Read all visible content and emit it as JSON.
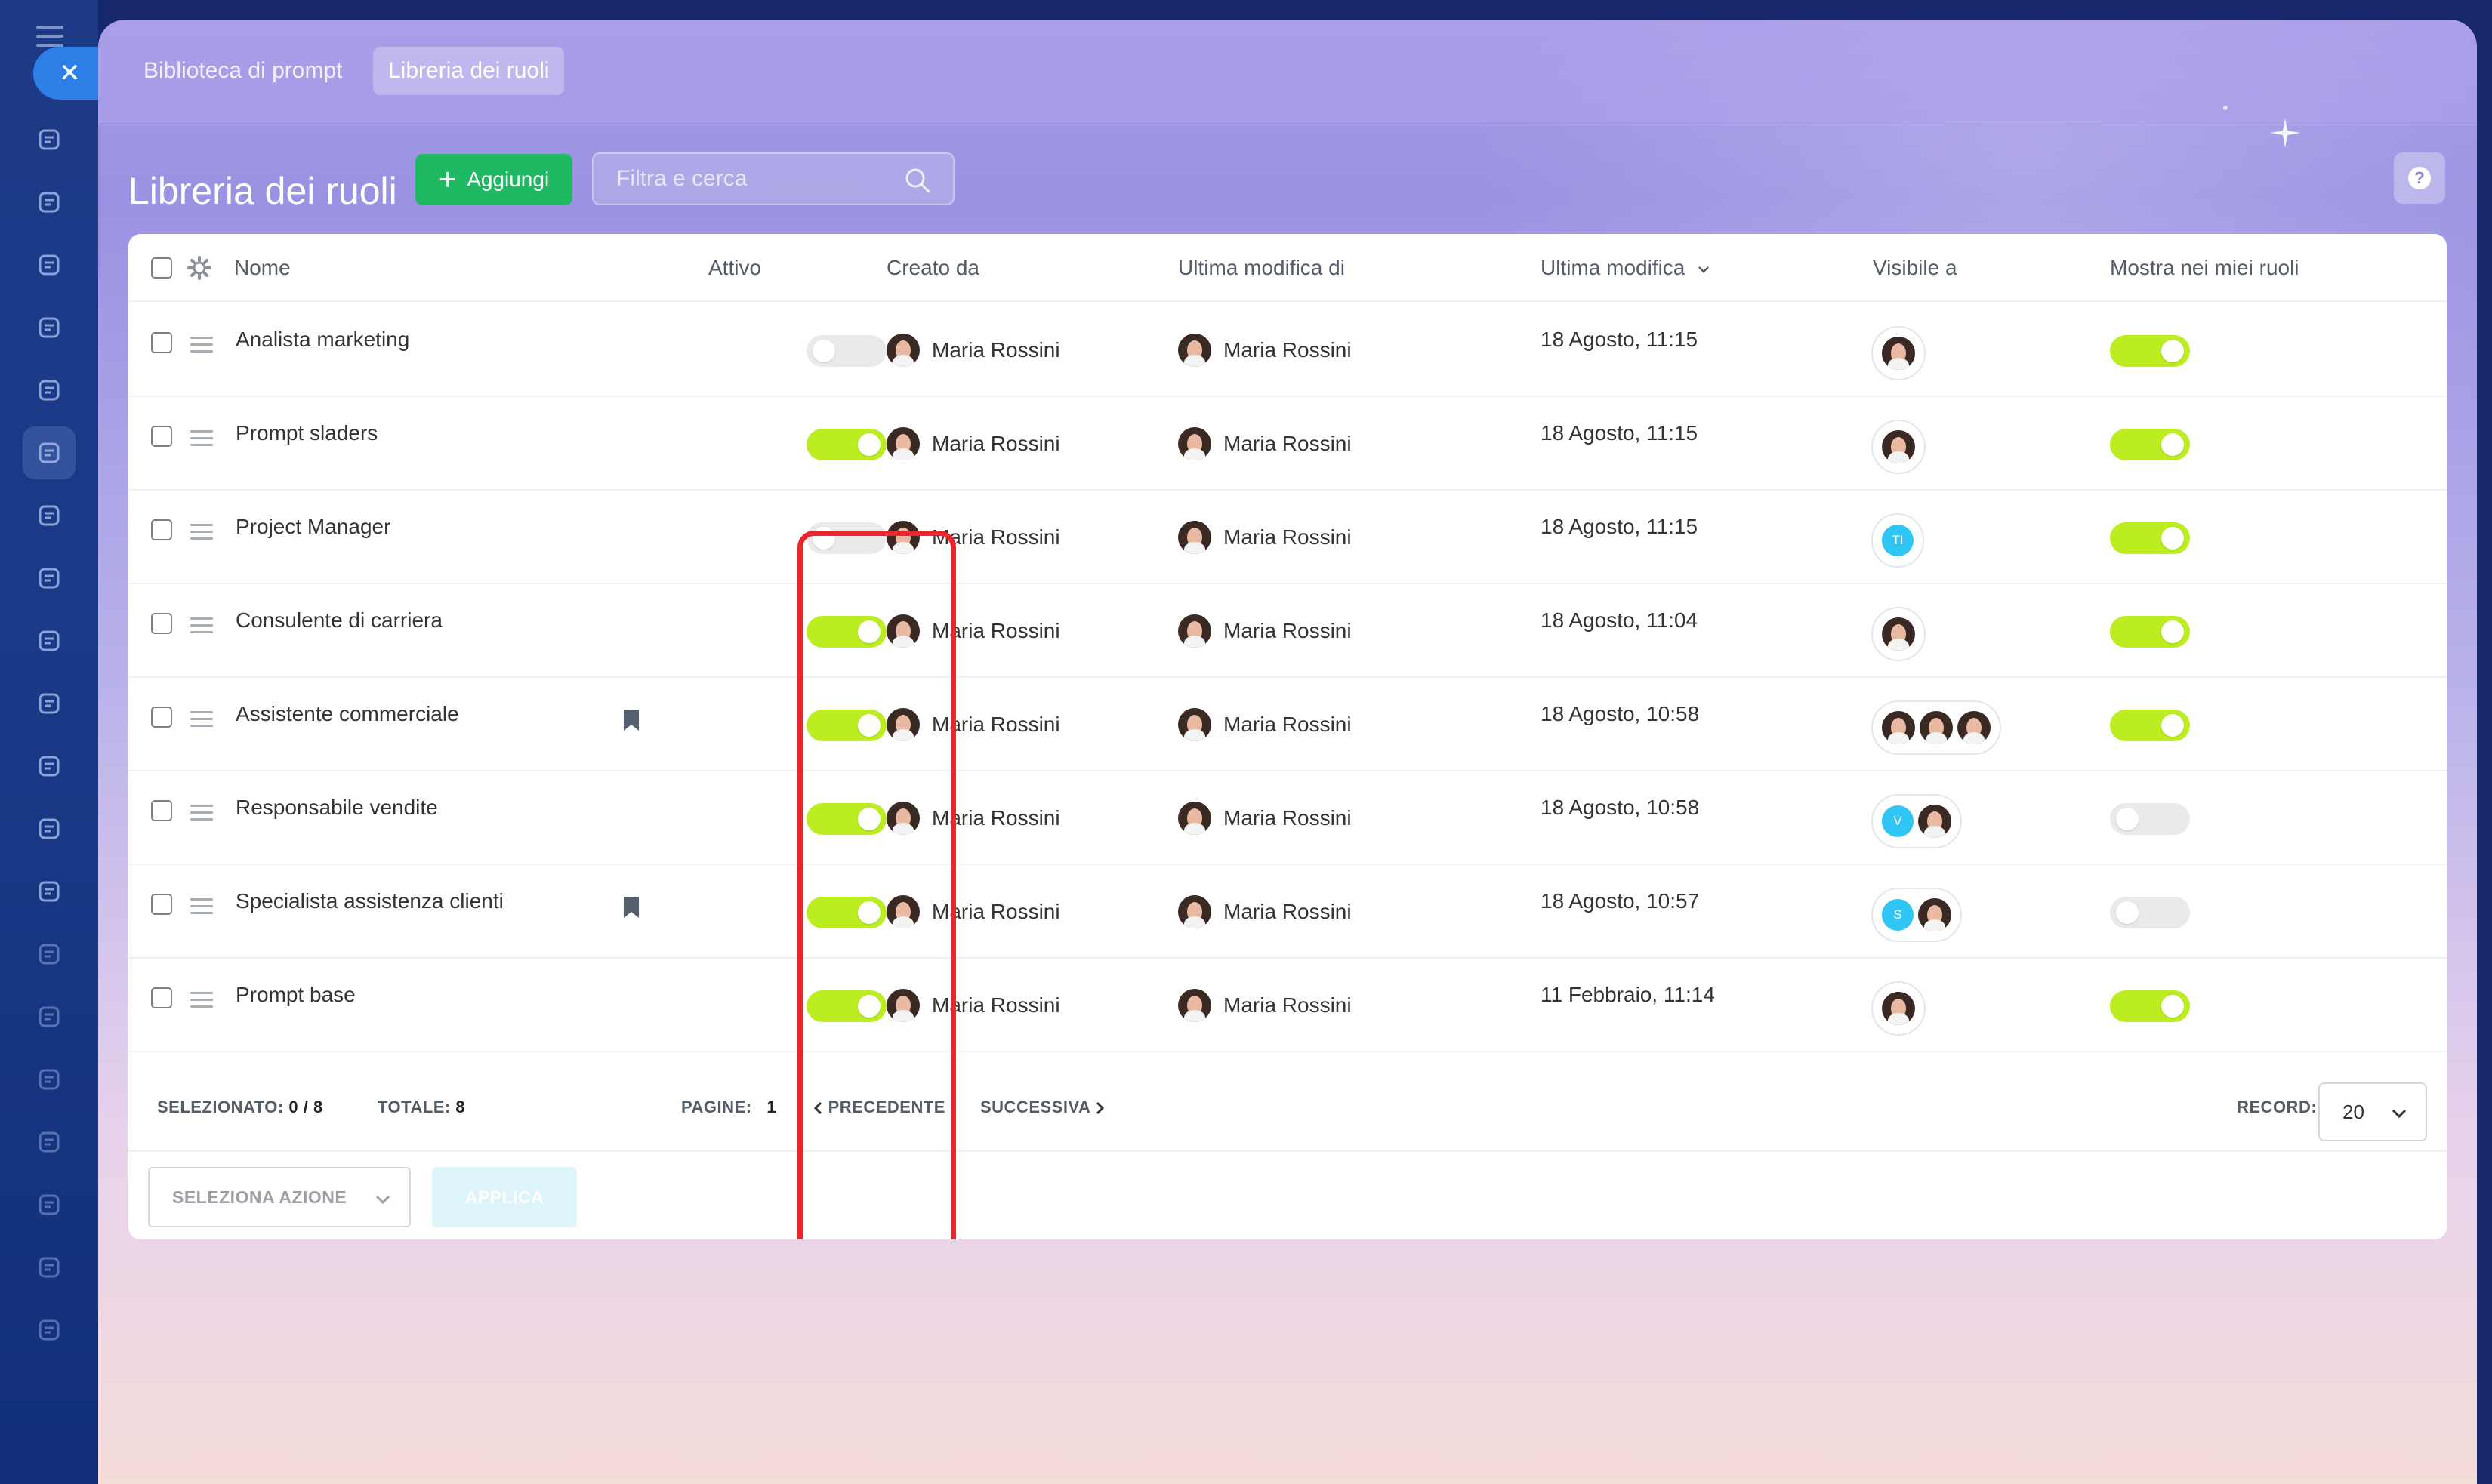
{
  "tabs": [
    {
      "label": "Biblioteca di prompt"
    },
    {
      "label": "Libreria dei ruoli"
    }
  ],
  "header": {
    "title": "Libreria dei ruoli",
    "add_label": "Aggiungi",
    "search_placeholder": "Filtra e cerca"
  },
  "table": {
    "columns": {
      "name": "Nome",
      "active": "Attivo",
      "created_by": "Creato da",
      "modified_by": "Ultima modifica di",
      "modified": "Ultima modifica",
      "visible_to": "Visibile a",
      "show_in_roles": "Mostra nei miei ruoli"
    },
    "rows": [
      {
        "name": "Analista marketing",
        "active": false,
        "created_by": "Maria Rossini",
        "modified_by": "Maria Rossini",
        "modified": "18 Agosto, 11:15",
        "visible_to": [
          "avatar"
        ],
        "show": true,
        "bookmark": false
      },
      {
        "name": "Prompt sladers",
        "active": true,
        "created_by": "Maria Rossini",
        "modified_by": "Maria Rossini",
        "modified": "18 Agosto, 11:15",
        "visible_to": [
          "avatar"
        ],
        "show": true,
        "bookmark": false
      },
      {
        "name": "Project Manager",
        "active": false,
        "created_by": "Maria Rossini",
        "modified_by": "Maria Rossini",
        "modified": "18 Agosto, 11:15",
        "visible_to": [
          "TI"
        ],
        "show": true,
        "bookmark": false
      },
      {
        "name": "Consulente di carriera",
        "active": true,
        "created_by": "Maria Rossini",
        "modified_by": "Maria Rossini",
        "modified": "18 Agosto, 11:04",
        "visible_to": [
          "avatar"
        ],
        "show": true,
        "bookmark": false
      },
      {
        "name": "Assistente commerciale",
        "active": true,
        "created_by": "Maria Rossini",
        "modified_by": "Maria Rossini",
        "modified": "18 Agosto, 10:58",
        "visible_to": [
          "avatar",
          "avatar",
          "avatar"
        ],
        "show": true,
        "bookmark": true
      },
      {
        "name": "Responsabile vendite",
        "active": true,
        "created_by": "Maria Rossini",
        "modified_by": "Maria Rossini",
        "modified": "18 Agosto, 10:58",
        "visible_to": [
          "V",
          "avatar"
        ],
        "show": false,
        "bookmark": false
      },
      {
        "name": "Specialista assistenza clienti",
        "active": true,
        "created_by": "Maria Rossini",
        "modified_by": "Maria Rossini",
        "modified": "18 Agosto, 10:57",
        "visible_to": [
          "S",
          "avatar"
        ],
        "show": false,
        "bookmark": true
      },
      {
        "name": "Prompt base",
        "active": true,
        "created_by": "Maria Rossini",
        "modified_by": "Maria Rossini",
        "modified": "11 Febbraio, 11:14",
        "visible_to": [
          "avatar"
        ],
        "show": true,
        "bookmark": false
      }
    ]
  },
  "footer": {
    "selected_label": "SELEZIONATO:",
    "selected_value": "0 / 8",
    "total_label": "TOTALE:",
    "total_value": "8",
    "pages_label": "PAGINE:",
    "pages_value": "1",
    "prev_label": "PRECEDENTE",
    "next_label": "SUCCESSIVA",
    "records_label": "RECORD:",
    "records_value": "20",
    "action_select_label": "SELEZIONA AZIONE",
    "apply_label": "APPLICA"
  },
  "colors": {
    "toggle_on": "#bbed21",
    "toggle_off": "#e9eaec",
    "add_button": "#1fb863",
    "highlight": "#e8262c",
    "initial_badge": "#2fc6f6"
  },
  "icons": {
    "rail": [
      "sync-icon",
      "chat-icon",
      "checkbox-task-icon",
      "hexagon-icon",
      "stamp-icon",
      "document-list-icon",
      "calendar-icon",
      "presentation-icon",
      "file-icon",
      "card-icon",
      "filter-icon",
      "cart-icon",
      "store-icon",
      "id-card-icon",
      "robot-icon",
      "books-icon",
      "calendar-grid-icon",
      "chart-icon",
      "document-edit-icon",
      "pencil-icon"
    ]
  }
}
